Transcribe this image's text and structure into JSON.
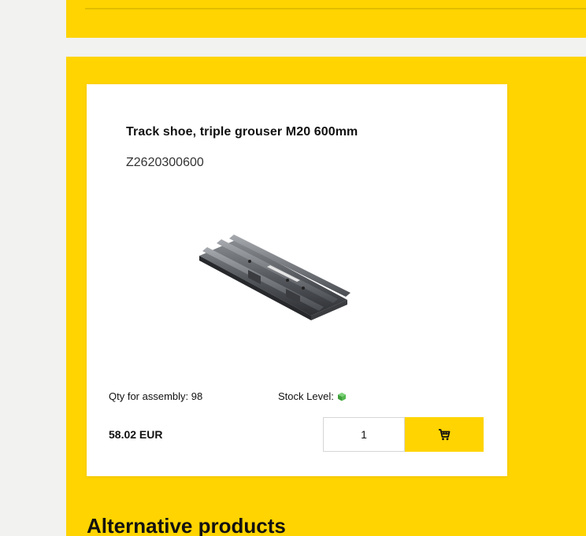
{
  "product": {
    "title": "Track shoe, triple grouser M20 600mm",
    "sku": "Z2620300600",
    "image": "track-shoe-image",
    "qty_for_assembly_label": "Qty for assembly: ",
    "qty_for_assembly_value": "98",
    "stock_level_label": "Stock Level:",
    "stock_icon": "green-cube-icon",
    "price": "58.02 EUR",
    "quantity": "1",
    "cart_icon": "cart-icon"
  },
  "alternatives": {
    "heading": "Alternative products"
  },
  "colors": {
    "brand_yellow": "#ffd400",
    "background": "#f2f2f0",
    "stock_green": "#4caf50"
  }
}
